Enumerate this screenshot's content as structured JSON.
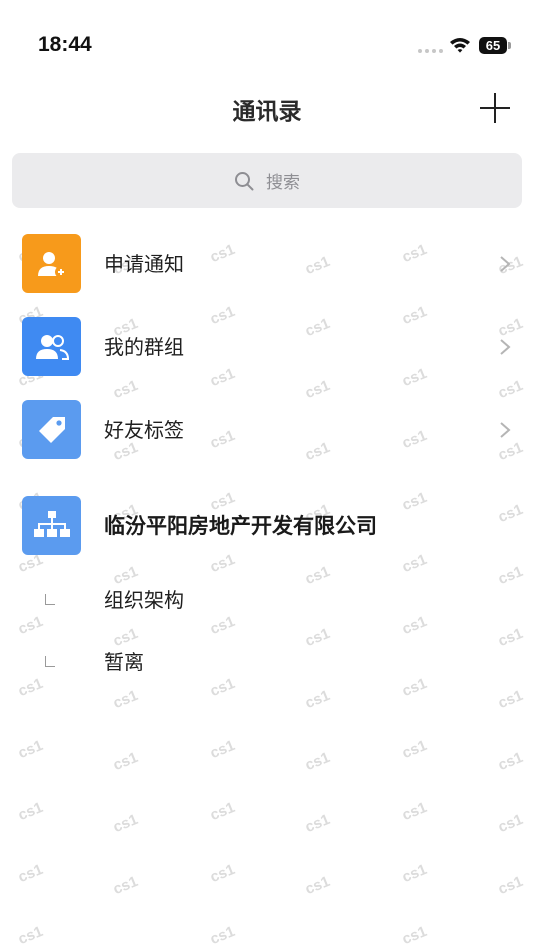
{
  "status_bar": {
    "time": "18:44",
    "battery": "65"
  },
  "header": {
    "title": "通讯录"
  },
  "search": {
    "placeholder": "搜索"
  },
  "menu": [
    {
      "label": "申请通知",
      "icon": "add-user-icon",
      "color": "#f79a1b"
    },
    {
      "label": "我的群组",
      "icon": "group-icon",
      "color": "#3f8af2"
    },
    {
      "label": "好友标签",
      "icon": "tag-icon",
      "color": "#5b9bef"
    }
  ],
  "organization": {
    "name": "临汾平阳房地产开发有限公司",
    "icon": "org-chart-icon",
    "children": [
      {
        "label": "组织架构"
      },
      {
        "label": "暂离"
      }
    ]
  },
  "watermark": "cs1"
}
